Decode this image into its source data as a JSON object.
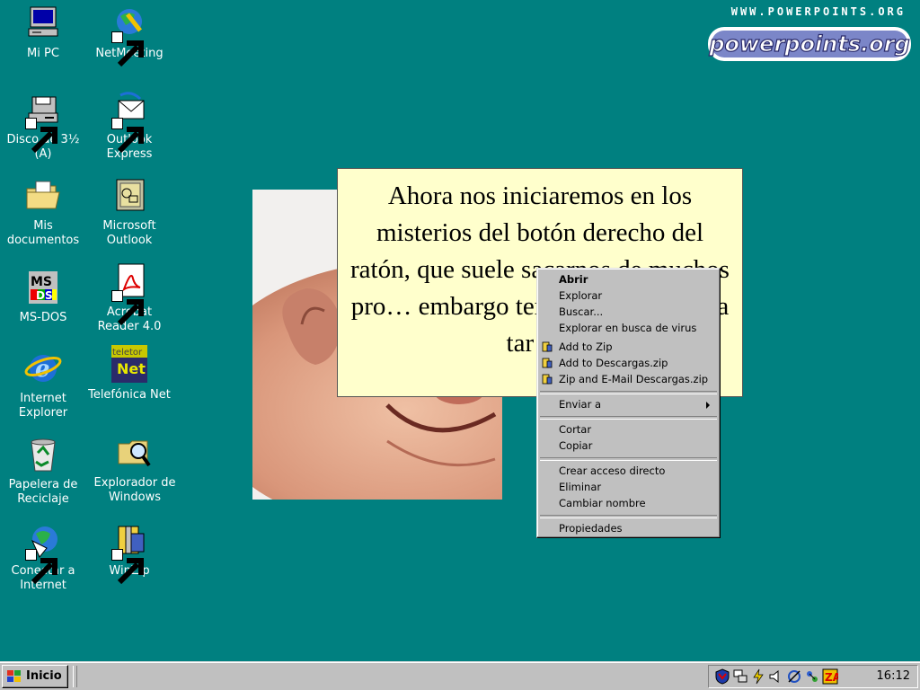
{
  "desktop": {
    "icons": [
      {
        "label": "Mi PC",
        "icon": "computer-icon"
      },
      {
        "label": "NetMeeting",
        "icon": "netmeeting-icon"
      },
      {
        "label": "Disco de 3½ (A)",
        "icon": "floppy-drive-icon"
      },
      {
        "label": "Outlook Express",
        "icon": "outlook-express-icon"
      },
      {
        "label": "Mis documentos",
        "icon": "folder-documents-icon"
      },
      {
        "label": "Microsoft Outlook",
        "icon": "microsoft-outlook-icon"
      },
      {
        "label": "MS-DOS",
        "icon": "ms-dos-icon"
      },
      {
        "label": "Acrobat Reader 4.0",
        "icon": "acrobat-reader-icon"
      },
      {
        "label": "Internet Explorer",
        "icon": "internet-explorer-icon"
      },
      {
        "label": "Telefónica Net",
        "icon": "telefonica-net-icon"
      },
      {
        "label": "Papelera de Reciclaje",
        "icon": "recycle-bin-icon"
      },
      {
        "label": "Explorador de Windows",
        "icon": "windows-explorer-icon"
      },
      {
        "label": "Conectar a Internet",
        "icon": "connect-internet-icon"
      },
      {
        "label": "WinZip",
        "icon": "winzip-icon"
      }
    ]
  },
  "logo": {
    "url_text": "WWW.POWERPOINTS.ORG",
    "brand": "powerpoints.org"
  },
  "callout": {
    "text": "Ahora nos iniciaremos en los misterios del botón derecho del ratón, que suele sacarnos de muchos pro… embargo tenga… herramienta tar… :"
  },
  "context_menu": {
    "items": [
      {
        "label": "Abrir",
        "bold": true
      },
      {
        "label": "Explorar"
      },
      {
        "label": "Buscar..."
      },
      {
        "label": "Explorar en busca de virus"
      },
      {
        "label": "Add to Zip",
        "icon": "winzip-icon"
      },
      {
        "label": "Add to Descargas.zip",
        "icon": "winzip-icon"
      },
      {
        "label": "Zip and E-Mail Descargas.zip",
        "icon": "winzip-icon"
      },
      {
        "label": "Enviar a",
        "submenu": true
      },
      {
        "label": "Cortar"
      },
      {
        "label": "Copiar"
      },
      {
        "label": "Crear acceso directo"
      },
      {
        "label": "Eliminar"
      },
      {
        "label": "Cambiar nombre"
      },
      {
        "label": "Propiedades"
      }
    ]
  },
  "taskbar": {
    "start_label": "Inicio",
    "clock": "16:12",
    "tray_icons": [
      "shield-icon",
      "network-icon",
      "power-icon",
      "volume-icon",
      "connection-icon",
      "tools-icon",
      "zonealarm-icon"
    ]
  },
  "colors": {
    "desktop": "#008080",
    "callout": "#ffffcc",
    "menu": "#c0c0c0"
  }
}
